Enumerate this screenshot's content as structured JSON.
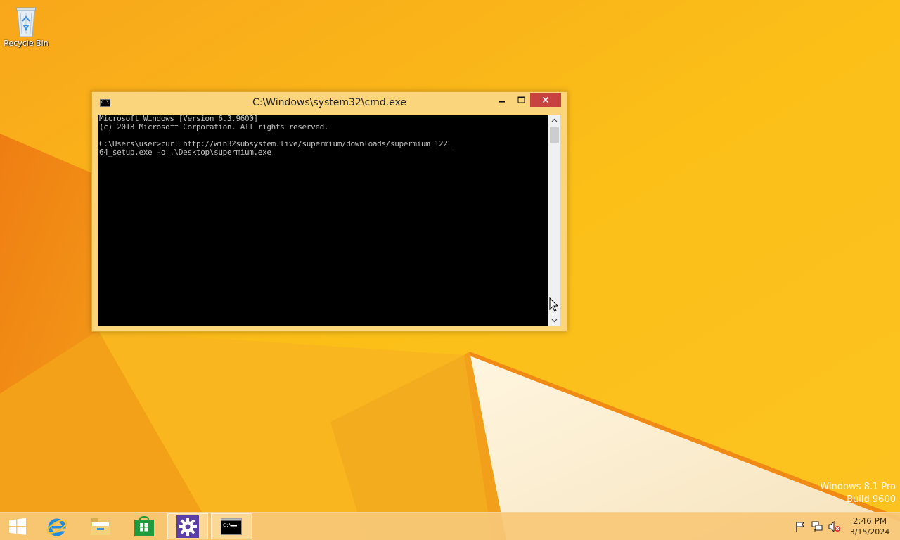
{
  "desktop": {
    "icons": [
      {
        "label": "Recycle Bin",
        "icon": "recycle-bin-icon"
      }
    ],
    "watermark": {
      "line1": "Windows 8.1 Pro",
      "line2": "Build 9600"
    }
  },
  "cmd_window": {
    "title": "C:\\Windows\\system32\\cmd.exe",
    "controls": {
      "minimize": "minimize-icon",
      "maximize": "maximize-icon",
      "close": "close-icon"
    },
    "console_lines": [
      "Microsoft Windows [Version 6.3.9600]",
      "(c) 2013 Microsoft Corporation. All rights reserved.",
      "",
      "C:\\Users\\user>curl http://win32subsystem.live/supermium/downloads/supermium_122_",
      "64_setup.exe -o .\\Desktop\\supermium.exe"
    ]
  },
  "taskbar": {
    "items": [
      {
        "name": "Start",
        "icon": "windows-logo-icon"
      },
      {
        "name": "Internet Explorer",
        "icon": "internet-explorer-icon"
      },
      {
        "name": "File Explorer",
        "icon": "folder-icon"
      },
      {
        "name": "Store",
        "icon": "store-icon"
      },
      {
        "name": "Settings",
        "icon": "gear-icon"
      },
      {
        "name": "Command Prompt",
        "icon": "cmd-icon"
      }
    ],
    "tray": {
      "icons": [
        "flag-icon",
        "network-icon",
        "speaker-muted-icon"
      ],
      "time": "2:46 PM",
      "date": "3/15/2024"
    }
  },
  "colors": {
    "wallpaper": "#f7b21a",
    "window_frame": "#fbd57b",
    "close_button": "#c7433f",
    "console_bg": "#000000",
    "console_text": "#c0c0c0"
  }
}
